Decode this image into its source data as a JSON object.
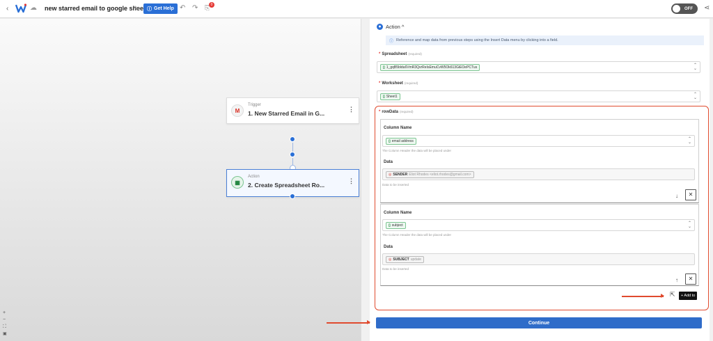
{
  "topbar": {
    "title": "new starred email to google sheets",
    "help_label": "Get Help",
    "history_badge": "0",
    "toggle_label": "OFF"
  },
  "canvas": {
    "trigger": {
      "kind": "Trigger",
      "title": "1. New Starred Email in G...",
      "icon": "gmail-icon"
    },
    "action": {
      "kind": "Action",
      "title": "2. Create Spreadsheet Ro...",
      "icon": "google-sheets-icon"
    },
    "zoom": {
      "in": "+",
      "out": "−",
      "fit": "⛶",
      "lock": "🔒"
    }
  },
  "panel": {
    "section_title": "Action ^",
    "info_text": "Reference and map data from previous steps using the Insert Data menu by clicking into a field.",
    "spreadsheet": {
      "label": "Spreadsheet",
      "required_note": "(required)",
      "value": "1_gqB5bldu6VmR3QvrReIsEmuCvW5Ok613GiEOePCTus"
    },
    "worksheet": {
      "label": "Worksheet",
      "required_note": "(required)",
      "value": "Sheet1"
    },
    "rowdata": {
      "label": "rowData",
      "required_note": "(required)",
      "rows": [
        {
          "column_label": "Column Name",
          "column_value": "email address",
          "column_help": "The Column Header the data will be placed under",
          "data_label": "Data",
          "data_token": "SENDER",
          "data_preview": "Eliot Rhodes <eliot.rhodes@gmail.com>",
          "data_help": "Data to be inserted",
          "move_icon": "↓"
        },
        {
          "column_label": "Column Name",
          "column_value": "subject",
          "column_help": "The Column Header the data will be placed under",
          "data_label": "Data",
          "data_token": "SUBJECT",
          "data_preview": "update",
          "data_help": "Data to be inserted",
          "move_icon": "↑"
        }
      ],
      "remove_icon": "✕",
      "add_label": "+ Add to"
    },
    "continue_label": "Continue"
  },
  "colors": {
    "accent": "#2a6fd6",
    "highlight": "#e04a2e",
    "sheets_green": "#188038"
  }
}
